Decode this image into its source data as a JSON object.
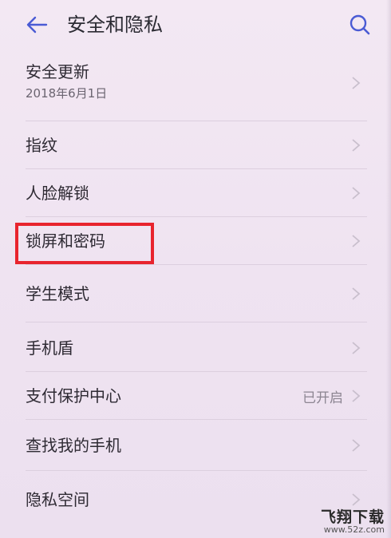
{
  "header": {
    "title": "安全和隐私"
  },
  "items": [
    {
      "title": "安全更新",
      "subtitle": "2018年6月1日",
      "value": ""
    },
    {
      "title": "指纹",
      "subtitle": "",
      "value": ""
    },
    {
      "title": "人脸解锁",
      "subtitle": "",
      "value": ""
    },
    {
      "title": "锁屏和密码",
      "subtitle": "",
      "value": ""
    },
    {
      "title": "学生模式",
      "subtitle": "",
      "value": ""
    },
    {
      "title": "手机盾",
      "subtitle": "",
      "value": ""
    },
    {
      "title": "支付保护中心",
      "subtitle": "",
      "value": "已开启"
    },
    {
      "title": "查找我的手机",
      "subtitle": "",
      "value": ""
    },
    {
      "title": "隐私空间",
      "subtitle": "",
      "value": ""
    }
  ],
  "watermark": {
    "brand": "飞翔下载",
    "url": "www.52z.com"
  },
  "colors": {
    "accent": "#4a5bd4",
    "highlight": "#e8242e",
    "background": "#f1e7f3"
  }
}
